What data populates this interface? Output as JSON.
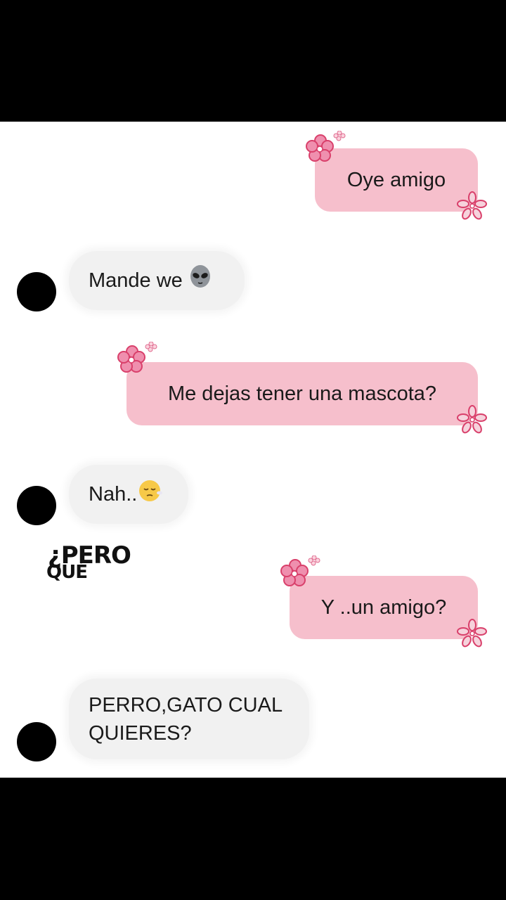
{
  "messages": [
    {
      "side": "sent",
      "text": "Oye amigo"
    },
    {
      "side": "received",
      "text": "Mande we",
      "icon": "alien-emoji"
    },
    {
      "side": "sent",
      "text": "Me dejas tener una mascota?"
    },
    {
      "side": "received",
      "text": "Nah..",
      "icon": "pensive-face-emoji"
    },
    {
      "side": "sent",
      "text": "Y ..un amigo?"
    },
    {
      "side": "received",
      "text": "PERRO,GATO CUAL QUIERES?"
    }
  ],
  "sticker": {
    "line1": "¿PERO",
    "line2": "QUÉ"
  },
  "colors": {
    "sent_bubble": "#f6bfcc",
    "received_bubble": "#f1f1f1",
    "flower": "#d9406b",
    "avatar": "#000000",
    "background": "#ffffff"
  }
}
